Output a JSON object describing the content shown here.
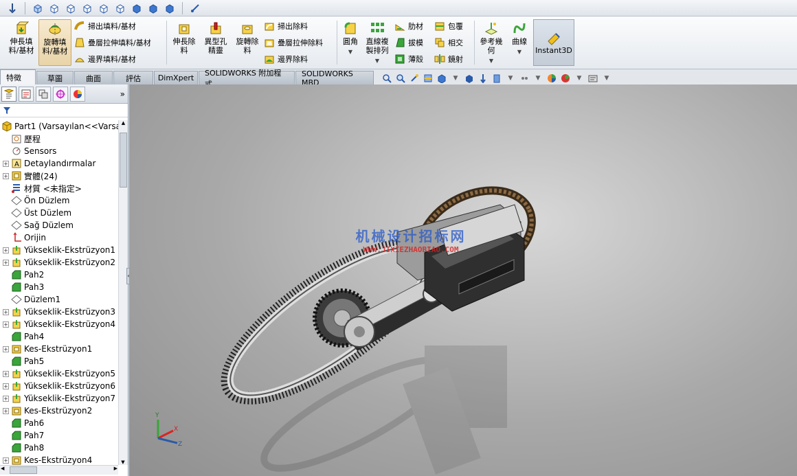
{
  "ribbon": {
    "big_buttons": [
      {
        "label": "伸長填\n料/基材"
      },
      {
        "label": "旋轉填\n料/基材"
      },
      {
        "label": "伸長除\n料"
      },
      {
        "label": "異型孔\n精靈"
      },
      {
        "label": "旋轉除\n料"
      },
      {
        "label": "圓角"
      },
      {
        "label": "直線複\n製排列"
      },
      {
        "label": "參考幾\n何"
      },
      {
        "label": "曲線"
      }
    ],
    "fill_small": [
      "掃出填料/基材",
      "疊層拉伸填料/基材",
      "邊界填料/基材"
    ],
    "cut_small": [
      "掃出除料",
      "疊層拉伸除料",
      "邊界除料"
    ],
    "features_small": [
      "肋材",
      "拔模",
      "薄殼",
      "包覆",
      "相交",
      "鏡射"
    ],
    "instant3d": "Instant3D"
  },
  "tabs": [
    "特徵",
    "草圖",
    "曲面",
    "評估",
    "DimXpert",
    "SOLIDWORKS 附加程式",
    "SOLIDWORKS MBD"
  ],
  "tree": {
    "root": "Part1  (Varsayılan<<Varsay",
    "items": [
      {
        "label": "歷程",
        "exp": false,
        "icon": "history-icon"
      },
      {
        "label": "Sensors",
        "exp": false,
        "icon": "sensor-icon"
      },
      {
        "label": "Detaylandırmalar",
        "exp": true,
        "icon": "annotation-icon"
      },
      {
        "label": "實體(24)",
        "exp": true,
        "icon": "solid-bodies-icon"
      },
      {
        "label": "材質 <未指定>",
        "exp": false,
        "icon": "material-icon"
      },
      {
        "label": "Ön Düzlem",
        "exp": false,
        "icon": "plane-icon"
      },
      {
        "label": "Üst Düzlem",
        "exp": false,
        "icon": "plane-icon"
      },
      {
        "label": "Sağ Düzlem",
        "exp": false,
        "icon": "plane-icon"
      },
      {
        "label": "Orijin",
        "exp": false,
        "icon": "origin-icon"
      },
      {
        "label": "Yükseklik-Ekstrüzyon1",
        "exp": true,
        "icon": "extrude-icon"
      },
      {
        "label": "Yükseklik-Ekstrüzyon2",
        "exp": true,
        "icon": "extrude-icon"
      },
      {
        "label": "Pah2",
        "exp": false,
        "icon": "chamfer-icon"
      },
      {
        "label": "Pah3",
        "exp": false,
        "icon": "chamfer-icon"
      },
      {
        "label": "Düzlem1",
        "exp": false,
        "icon": "plane-icon"
      },
      {
        "label": "Yükseklik-Ekstrüzyon3",
        "exp": true,
        "icon": "extrude-icon"
      },
      {
        "label": "Yükseklik-Ekstrüzyon4",
        "exp": true,
        "icon": "extrude-icon"
      },
      {
        "label": "Pah4",
        "exp": false,
        "icon": "chamfer-icon"
      },
      {
        "label": "Kes-Ekstrüzyon1",
        "exp": true,
        "icon": "cut-icon"
      },
      {
        "label": "Pah5",
        "exp": false,
        "icon": "chamfer-icon"
      },
      {
        "label": "Yükseklik-Ekstrüzyon5",
        "exp": true,
        "icon": "extrude-icon"
      },
      {
        "label": "Yükseklik-Ekstrüzyon6",
        "exp": true,
        "icon": "extrude-icon"
      },
      {
        "label": "Yükseklik-Ekstrüzyon7",
        "exp": true,
        "icon": "extrude-icon"
      },
      {
        "label": "Kes-Ekstrüzyon2",
        "exp": true,
        "icon": "cut-icon"
      },
      {
        "label": "Pah6",
        "exp": false,
        "icon": "chamfer-icon"
      },
      {
        "label": "Pah7",
        "exp": false,
        "icon": "chamfer-icon"
      },
      {
        "label": "Pah8",
        "exp": false,
        "icon": "chamfer-icon"
      },
      {
        "label": "Kes-Ekstrüzyon4",
        "exp": true,
        "icon": "cut-icon"
      }
    ]
  },
  "watermark": {
    "cn": "机械设计招标网",
    "url": "WWW.JIXIEZHAOBIAO.COM"
  },
  "triad": {
    "x": "X",
    "y": "Y",
    "z": "Z"
  },
  "colors": {
    "accent_yellow": "#f0c020",
    "feature_green": "#3aa53a",
    "viewport": "#a9a9a9"
  }
}
